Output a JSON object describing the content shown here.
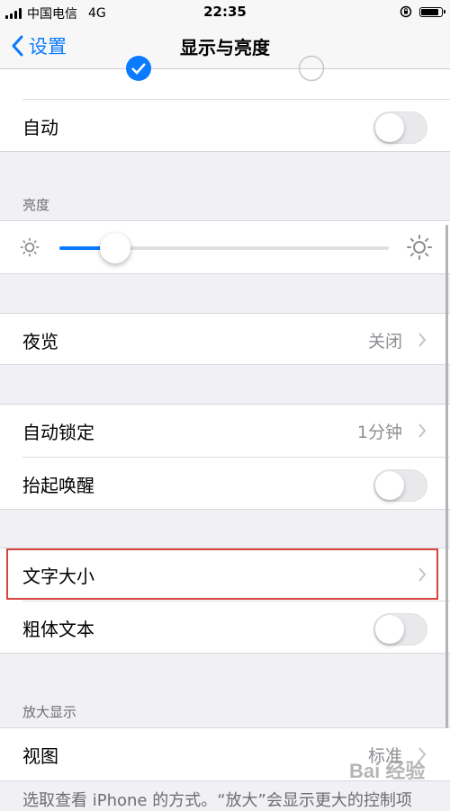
{
  "status": {
    "carrier": "中国电信",
    "network": "4G",
    "time": "22:35"
  },
  "nav": {
    "back_label": "设置",
    "title": "显示与亮度"
  },
  "appearance": {
    "auto_label": "自动",
    "auto_on": false
  },
  "brightness": {
    "header": "亮度",
    "level": 0.17
  },
  "night_shift": {
    "label": "夜览",
    "value": "关闭"
  },
  "lock": {
    "auto_lock_label": "自动锁定",
    "auto_lock_value": "1分钟",
    "raise_to_wake_label": "抬起唤醒",
    "raise_to_wake_on": false
  },
  "text": {
    "text_size_label": "文字大小",
    "bold_text_label": "粗体文本",
    "bold_text_on": false
  },
  "zoom": {
    "header": "放大显示",
    "view_label": "视图",
    "view_value": "标准",
    "footer": "选取查看 iPhone 的方式。“放大”会显示更大的控制项"
  },
  "watermark": "Bai 经验",
  "colors": {
    "accent": "#0a7aff",
    "highlight": "#d9433e"
  }
}
